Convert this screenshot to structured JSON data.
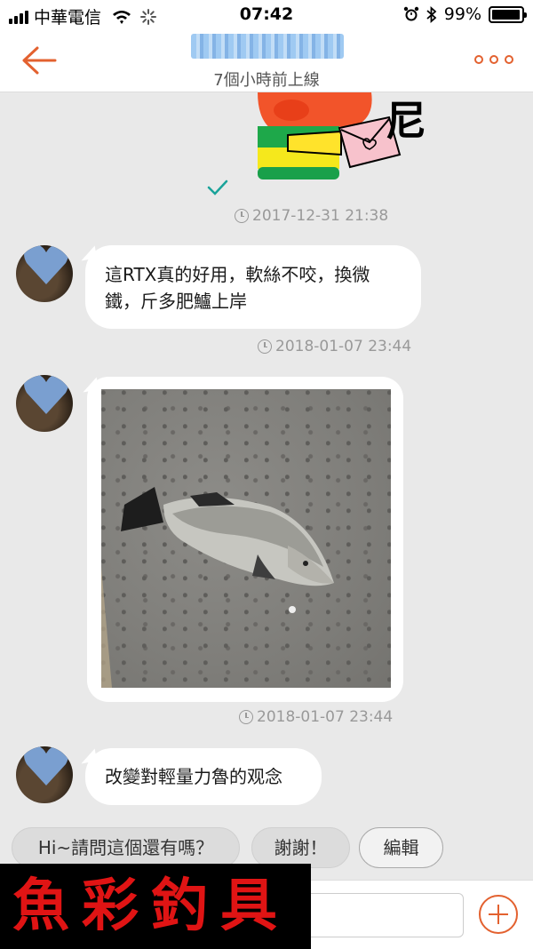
{
  "status_bar": {
    "carrier": "中華電信",
    "time": "07:42",
    "battery": "99%",
    "battery_level": 0.99,
    "icons": [
      "signal-icon",
      "wifi-icon",
      "loading-icon",
      "alarm-icon",
      "bluetooth-icon",
      "battery-icon"
    ]
  },
  "header": {
    "contact_name": "",
    "last_seen": "7個小時前上線",
    "icons": [
      "back-arrow-icon",
      "more-icon"
    ]
  },
  "messages": [
    {
      "type": "sticker",
      "sender": "me",
      "sticker_text": "尼",
      "timestamp": "2017-12-31 21:38",
      "read": true
    },
    {
      "type": "text",
      "sender": "other",
      "text": "這RTX真的好用，軟絲不咬，換微鐵，斤多肥鱸上岸",
      "timestamp": "2018-01-07 23:44"
    },
    {
      "type": "image",
      "sender": "other",
      "image_subject": "fish",
      "timestamp": "2018-01-07 23:44"
    },
    {
      "type": "text",
      "sender": "other",
      "text": "改變對輕量力魯的观念"
    }
  ],
  "quick_replies": [
    "Hi~請問這個還有嗎？",
    "謝謝！",
    "編輯"
  ],
  "composer": {
    "placeholder": "",
    "icons": [
      "plus-icon"
    ]
  },
  "watermark": "魚彩釣具",
  "colors": {
    "accent": "#e3612f",
    "background": "#e9e9e9",
    "bubble": "#ffffff",
    "read_check": "#1aa39a",
    "watermark_text": "#e01414"
  }
}
